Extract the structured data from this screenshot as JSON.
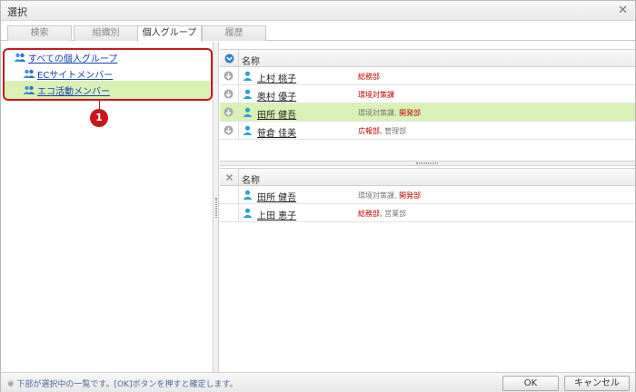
{
  "dialog": {
    "title": "選択"
  },
  "tabs": [
    {
      "label": "検索"
    },
    {
      "label": "組織別"
    },
    {
      "label": "個人グループ"
    },
    {
      "label": "履歴"
    }
  ],
  "tree": {
    "items": [
      {
        "label": "すべての個人グループ"
      },
      {
        "label": "ECサイトメンバー"
      },
      {
        "label": "エコ活動メンバー"
      }
    ]
  },
  "callout": {
    "number": "1"
  },
  "upper_grid": {
    "header": "名称",
    "rows": [
      {
        "name": "上村 桃子",
        "dept": [
          "総務部"
        ]
      },
      {
        "name": "奥村 優子",
        "dept": [
          "環境対策課"
        ]
      },
      {
        "name": "田所 健吾",
        "dept": [
          "環境対策課,",
          "開発部"
        ]
      },
      {
        "name": "笹倉 佳美",
        "dept": [
          "広報部,",
          "管理部"
        ]
      }
    ]
  },
  "lower_grid": {
    "header": "名称",
    "rows": [
      {
        "name": "田所 健吾",
        "dept": [
          "環境対策課,",
          "開発部"
        ]
      },
      {
        "name": "上田 恵子",
        "dept": [
          "総務部,",
          "営業部"
        ]
      }
    ]
  },
  "footer": {
    "note": "※ 下部が選択中の一覧です。[OK]ボタンを押すと確定します。",
    "ok_label": "OK",
    "cancel_label": "キャンセル"
  },
  "colors": {
    "accent_red": "#c8171d",
    "selected_row": "#d9f2b3",
    "link_blue": "#1a3fb5"
  }
}
